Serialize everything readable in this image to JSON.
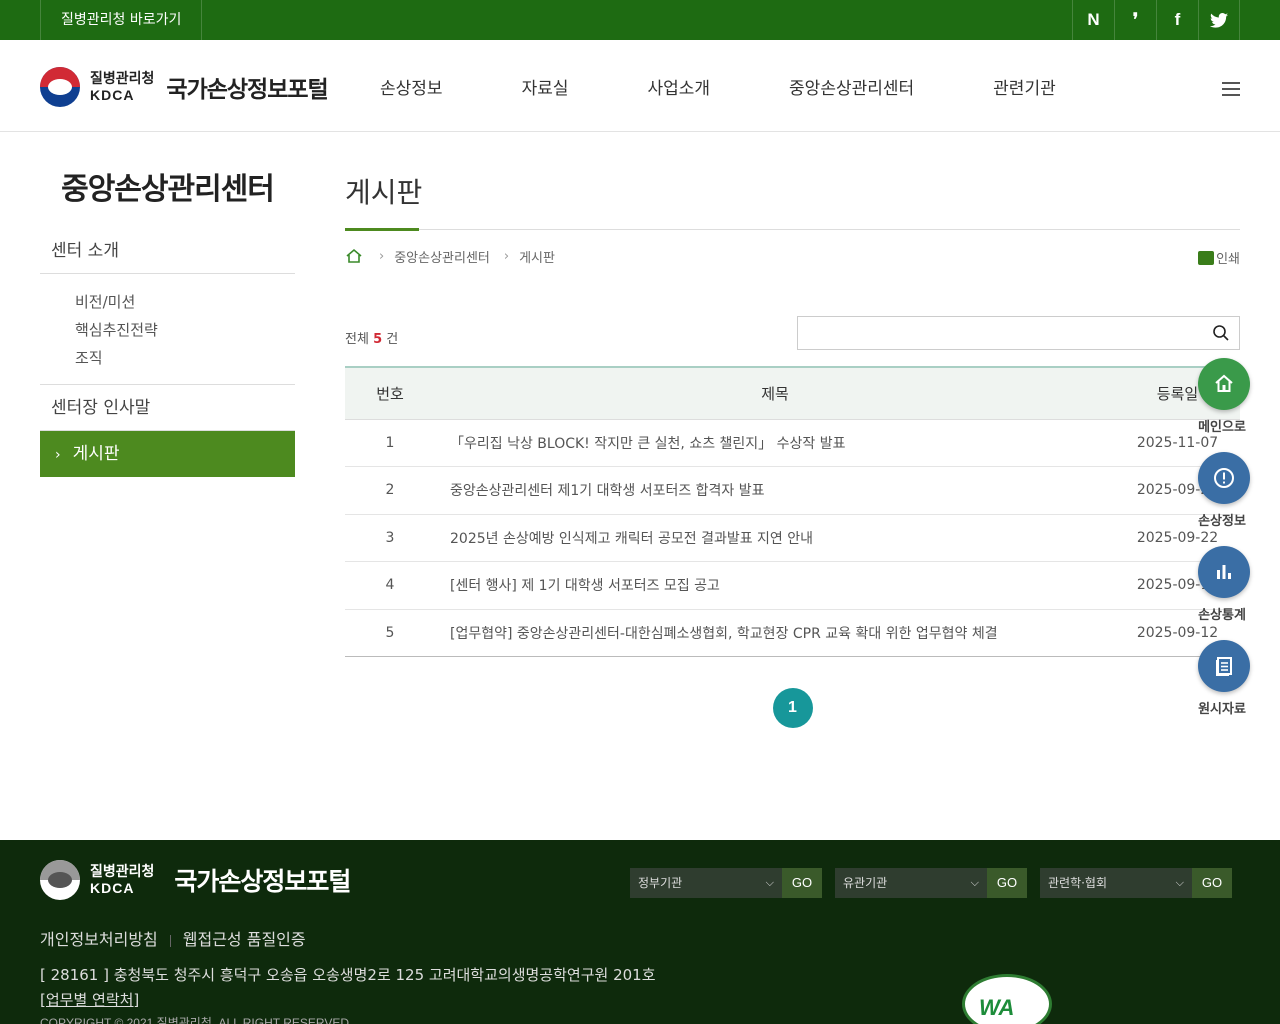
{
  "topbar": {
    "shortcut": "질병관리청 바로가기",
    "sns": [
      "N",
      "❜",
      "f",
      "t"
    ]
  },
  "header": {
    "agency": "질병관리청",
    "agency_en": "KDCA",
    "portal_title": "국가손상정보포털",
    "nav": [
      "손상정보",
      "자료실",
      "사업소개",
      "중앙손상관리센터",
      "관련기관"
    ]
  },
  "sidebar": {
    "title": "중앙손상관리센터",
    "intro": "센터 소개",
    "sub_items": [
      "비전/미션",
      "핵심추진전략",
      "조직"
    ],
    "greeting": "센터장 인사말",
    "active": "게시판"
  },
  "content": {
    "page_title": "게시판",
    "breadcrumb": [
      "중앙손상관리센터",
      "게시판"
    ],
    "print_label": "인쇄",
    "total_prefix": "전체",
    "total_count": "5",
    "total_suffix": "건",
    "search_placeholder": "",
    "columns": [
      "번호",
      "제목",
      "등록일"
    ],
    "rows": [
      {
        "num": "1",
        "title": "「우리집 낙상 BLOCK! 작지만 큰 실천, 쇼츠 챌린지」 수상작 발표",
        "date": "2025-11-07"
      },
      {
        "num": "2",
        "title": "중앙손상관리센터 제1기 대학생 서포터즈 합격자 발표",
        "date": "2025-09-22"
      },
      {
        "num": "3",
        "title": "2025년 손상예방 인식제고 캐릭터 공모전 결과발표 지연 안내",
        "date": "2025-09-22"
      },
      {
        "num": "4",
        "title": "[센터 행사] 제 1기 대학생 서포터즈 모집 공고",
        "date": "2025-09-12"
      },
      {
        "num": "5",
        "title": "[업무협약] 중앙손상관리센터-대한심폐소생협회, 학교현장 CPR 교육 확대 위한 업무협약 체결",
        "date": "2025-09-12"
      }
    ],
    "current_page": "1"
  },
  "quick_menu": [
    {
      "label": "메인으로",
      "icon": "home-icon",
      "color": "#3a9a4a"
    },
    {
      "label": "손상정보",
      "icon": "alert-icon",
      "color": "#3a6ea5"
    },
    {
      "label": "손상통계",
      "icon": "bar-chart-icon",
      "color": "#3a6ea5"
    },
    {
      "label": "원시자료",
      "icon": "document-icon",
      "color": "#3a6ea5"
    }
  ],
  "footer": {
    "agency": "질병관리청",
    "agency_en": "KDCA",
    "portal_title": "국가손상정보포털",
    "selects": [
      {
        "label": "정부기관",
        "go": "GO"
      },
      {
        "label": "유관기관",
        "go": "GO"
      },
      {
        "label": "관련학·협회",
        "go": "GO"
      }
    ],
    "links": [
      "개인정보처리방침",
      "웹접근성 품질인증"
    ],
    "address": "[ 28161 ] 충청북도 청주시 흥덕구 오송읍 오송생명2로 125 고려대학교의생명공학연구원 201호",
    "contact": "[업무별 연락처]",
    "copyright": "COPYRIGHT © 2021 질병관리청. ALL RIGHT RESERVED",
    "wa_mark": "WA"
  }
}
